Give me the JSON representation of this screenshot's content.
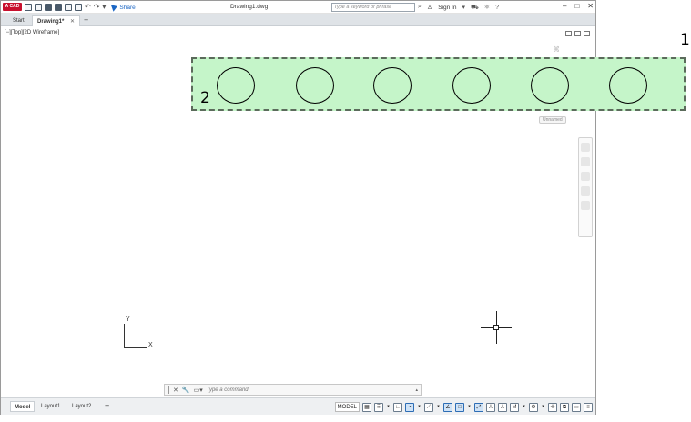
{
  "titlebar": {
    "app_logo": "A CAD",
    "document_title": "Drawing1.dwg",
    "search_placeholder": "Type a keyword or phrase",
    "share_label": "Share",
    "sign_in_label": "Sign In",
    "icons": [
      "new-icon",
      "open-icon",
      "save-icon",
      "save-as-icon",
      "web-mobile-icon",
      "print-icon",
      "undo-icon",
      "redo-icon",
      "workspace-dropdown-icon",
      "share-icon",
      "search-icon",
      "user-icon",
      "cart-icon",
      "exchange-icon",
      "help-icon"
    ],
    "window_controls": {
      "minimize": "–",
      "maximize": "□",
      "close": "✕"
    }
  },
  "file_tabs": {
    "start_label": "Start",
    "active_label": "Drawing1*",
    "close_glyph": "✕",
    "add_glyph": "+"
  },
  "viewport": {
    "label": "[−][Top][2D Wireframe]",
    "named_view": "Unnamed",
    "ucs": {
      "y_label": "Y",
      "x_label": "X"
    },
    "circle_count": 6,
    "highlight_color": "#c5f5c9"
  },
  "annotations": {
    "label_1": "1",
    "label_2": "2"
  },
  "command_line": {
    "placeholder": "Type a command",
    "close_glyph": "✕",
    "options_glyph": "🔧"
  },
  "layout_tabs": {
    "model": "Model",
    "layout1": "Layout1",
    "layout2": "Layout2",
    "add": "+"
  },
  "status_bar": {
    "model_label": "MODEL",
    "icons": [
      "grid-icon",
      "snap-icon",
      "ortho-icon",
      "polar-icon",
      "isodraft-icon",
      "osnap-tracking-icon",
      "osnap-icon",
      "lineweight-icon",
      "transparency-icon",
      "selection-cycling-icon",
      "annotation-scale-icon",
      "workspace-icon",
      "annotation-monitor-icon",
      "units-icon",
      "quick-properties-icon",
      "customize-icon"
    ]
  }
}
